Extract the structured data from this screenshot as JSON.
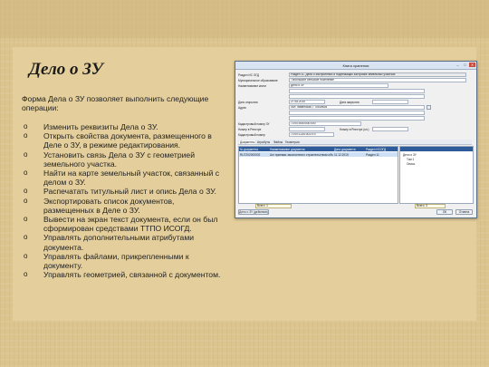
{
  "slide": {
    "title": "Дело о ЗУ",
    "intro": "Форма Дела о ЗУ позволяет выполнить следующие операции:",
    "bullet_char": "o",
    "operations": [
      "Изменить реквизиты Дела о ЗУ.",
      "Открыть свойства документа, размещенного в Деле о ЗУ, в режиме редактирования.",
      "Установить связь Дела о ЗУ с геометрией земельного участка.",
      "Найти на карте земельный участок, связанный с делом о ЗУ.",
      "Распечатать титульный лист и опись Дела о ЗУ.",
      "Экспортировать список документов, размещенных в Деле о ЗУ.",
      "Вывести на экран текст документа, если он был сформирован средствами ТТПО ИСОГД.",
      "Управлять дополнительными атрибутами документа.",
      "Управлять файлами, прикрепленными к документу.",
      "Управлять геометрией, связанной с документом."
    ]
  },
  "window": {
    "title": "Книга хранения",
    "controls": [
      "–",
      "□",
      "✕"
    ],
    "fields": [
      {
        "label": "Раздел ИС ОГД",
        "value": "Раздел 11. Дела о застроенных и подлежащих застройке земельных участках"
      },
      {
        "label": "Муниципальное образование",
        "value": "Тобольское сельское поселение"
      },
      {
        "label": "Наименование книги",
        "value": "Дело о ЗУ"
      },
      {
        "label": "Дата открытия",
        "value": "27.08.2015"
      },
      {
        "label": "Адрес",
        "value": "обл Тюменская, г Тобольск"
      },
      {
        "label": "Кадастровый номер ЗУ",
        "value": "72:00:0000000:000"
      },
      {
        "label": "Номер в Реестре",
        "value": ""
      },
      {
        "label": "Кадастровый номер",
        "value": "72:00:1234:401:0:0"
      }
    ],
    "right_fields": [
      {
        "label": "Дата закрытия",
        "value": ""
      },
      {
        "label": "Номер в Реестре (кн.)",
        "value": ""
      }
    ],
    "tabs": [
      "Документы",
      "Атрибуты",
      "Файлы",
      "Геометрия"
    ],
    "doc_table": {
      "columns": [
        "№ документа",
        "Наименование документа",
        "Дата документа",
        "Раздел ИСОГД"
      ],
      "rows": [
        {
          "num": "RU7202000002",
          "name": "Акт приемки законченного строительством объекта",
          "date": "11.12.2015",
          "section": "Раздел 11"
        }
      ],
      "count_label": "Всего: 1"
    },
    "tree": {
      "items": [
        "Дело о ЗУ",
        "Том 1",
        "Опись"
      ],
      "count_label": "Всего: 3"
    },
    "buttons": {
      "left": "Дело о ЗУ (действия)",
      "ok": "ОК",
      "cancel": "Отмена"
    }
  }
}
